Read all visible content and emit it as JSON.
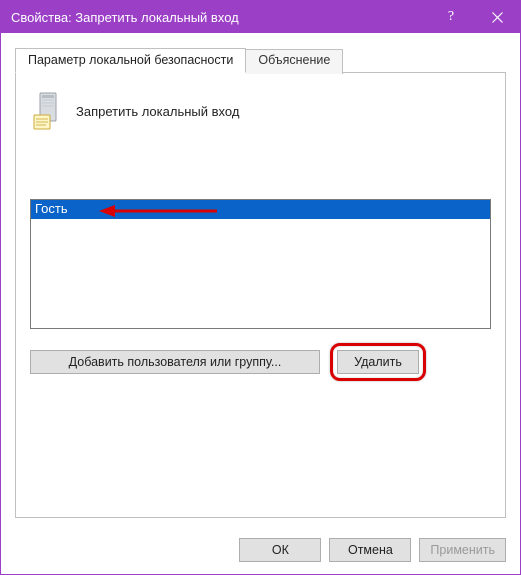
{
  "window": {
    "title": "Свойства: Запретить локальный вход"
  },
  "tabs": {
    "security": "Параметр локальной безопасности",
    "explain": "Объяснение"
  },
  "policy": {
    "name": "Запретить локальный вход"
  },
  "list": {
    "items": [
      "Гость"
    ]
  },
  "buttons": {
    "add": "Добавить пользователя или группу...",
    "remove": "Удалить",
    "ok": "ОК",
    "cancel": "Отмена",
    "apply": "Применить"
  }
}
